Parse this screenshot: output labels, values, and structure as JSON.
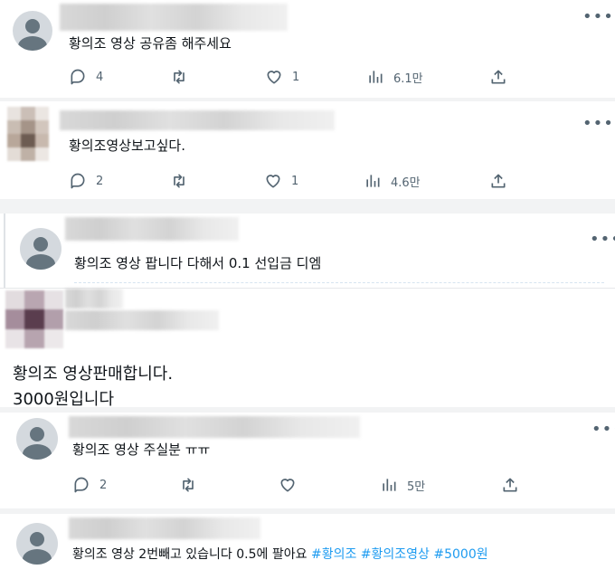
{
  "posts": [
    {
      "text": "황의조 영상 공유좀 해주세요",
      "actions": {
        "replies": "4",
        "likes": "1",
        "views": "6.1만"
      }
    },
    {
      "text": "황의조영상보고싶다.",
      "actions": {
        "replies": "2",
        "likes": "1",
        "views": "4.6만"
      }
    },
    {
      "text": "황의조 영상 팝니다 다해서 0.1 선입금 디엠"
    },
    {
      "text_line1": "황의조 영상판매합니다.",
      "text_line2": "3000원입니다"
    },
    {
      "text": "황의조 영상 주실분 ㅠㅠ",
      "actions": {
        "replies": "2",
        "views": "5만"
      }
    },
    {
      "text": "황의조 영상 2번빼고 있습니다 0.5에 팔아요",
      "hashtags": [
        "#황의조",
        "#황의조영상",
        "#5000원"
      ]
    }
  ],
  "icons": {
    "reply": "speech-bubble-icon",
    "retweet": "retweet-arrows-icon",
    "like": "heart-icon",
    "views": "bar-chart-icon",
    "share": "share-upload-icon",
    "more": "more-dots-icon",
    "avatar": "default-avatar-icon"
  },
  "colors": {
    "text": "#0f1419",
    "secondary": "#536471",
    "hashtag": "#1d9bf0",
    "separator": "#e6e8ea"
  }
}
